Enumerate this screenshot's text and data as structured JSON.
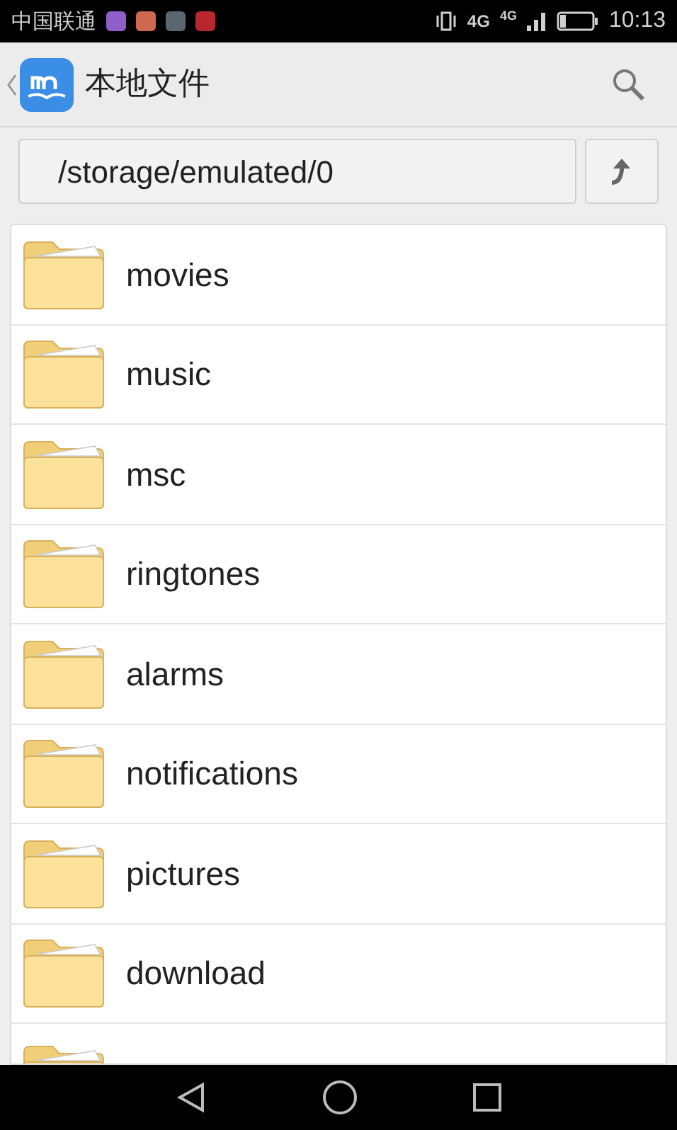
{
  "status_bar": {
    "carrier": "中国联通",
    "network_1": "4G",
    "network_2": "4G",
    "time": "10:13"
  },
  "header": {
    "title": "本地文件"
  },
  "path_bar": {
    "path": "/storage/emulated/0"
  },
  "folders": [
    {
      "name": "movies"
    },
    {
      "name": "music"
    },
    {
      "name": "msc"
    },
    {
      "name": "ringtones"
    },
    {
      "name": "alarms"
    },
    {
      "name": "notifications"
    },
    {
      "name": "pictures"
    },
    {
      "name": "download"
    },
    {
      "kind": "partial"
    }
  ]
}
